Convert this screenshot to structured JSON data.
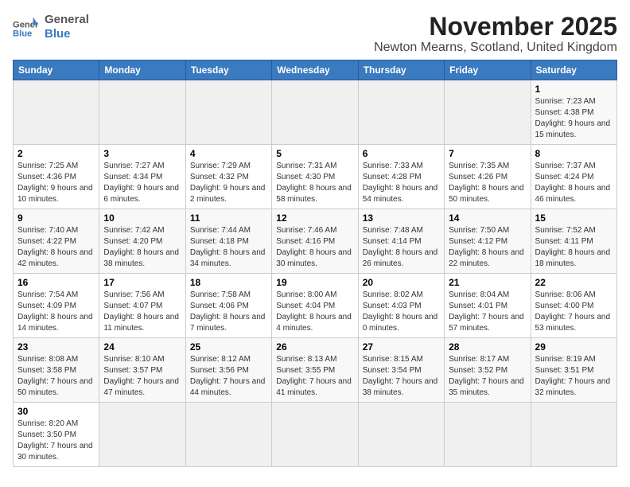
{
  "header": {
    "logo_general": "General",
    "logo_blue": "Blue",
    "month_title": "November 2025",
    "location": "Newton Mearns, Scotland, United Kingdom"
  },
  "weekdays": [
    "Sunday",
    "Monday",
    "Tuesday",
    "Wednesday",
    "Thursday",
    "Friday",
    "Saturday"
  ],
  "weeks": [
    [
      {
        "day": "",
        "info": ""
      },
      {
        "day": "",
        "info": ""
      },
      {
        "day": "",
        "info": ""
      },
      {
        "day": "",
        "info": ""
      },
      {
        "day": "",
        "info": ""
      },
      {
        "day": "",
        "info": ""
      },
      {
        "day": "1",
        "info": "Sunrise: 7:23 AM\nSunset: 4:38 PM\nDaylight: 9 hours and 15 minutes."
      }
    ],
    [
      {
        "day": "2",
        "info": "Sunrise: 7:25 AM\nSunset: 4:36 PM\nDaylight: 9 hours and 10 minutes."
      },
      {
        "day": "3",
        "info": "Sunrise: 7:27 AM\nSunset: 4:34 PM\nDaylight: 9 hours and 6 minutes."
      },
      {
        "day": "4",
        "info": "Sunrise: 7:29 AM\nSunset: 4:32 PM\nDaylight: 9 hours and 2 minutes."
      },
      {
        "day": "5",
        "info": "Sunrise: 7:31 AM\nSunset: 4:30 PM\nDaylight: 8 hours and 58 minutes."
      },
      {
        "day": "6",
        "info": "Sunrise: 7:33 AM\nSunset: 4:28 PM\nDaylight: 8 hours and 54 minutes."
      },
      {
        "day": "7",
        "info": "Sunrise: 7:35 AM\nSunset: 4:26 PM\nDaylight: 8 hours and 50 minutes."
      },
      {
        "day": "8",
        "info": "Sunrise: 7:37 AM\nSunset: 4:24 PM\nDaylight: 8 hours and 46 minutes."
      }
    ],
    [
      {
        "day": "9",
        "info": "Sunrise: 7:40 AM\nSunset: 4:22 PM\nDaylight: 8 hours and 42 minutes."
      },
      {
        "day": "10",
        "info": "Sunrise: 7:42 AM\nSunset: 4:20 PM\nDaylight: 8 hours and 38 minutes."
      },
      {
        "day": "11",
        "info": "Sunrise: 7:44 AM\nSunset: 4:18 PM\nDaylight: 8 hours and 34 minutes."
      },
      {
        "day": "12",
        "info": "Sunrise: 7:46 AM\nSunset: 4:16 PM\nDaylight: 8 hours and 30 minutes."
      },
      {
        "day": "13",
        "info": "Sunrise: 7:48 AM\nSunset: 4:14 PM\nDaylight: 8 hours and 26 minutes."
      },
      {
        "day": "14",
        "info": "Sunrise: 7:50 AM\nSunset: 4:12 PM\nDaylight: 8 hours and 22 minutes."
      },
      {
        "day": "15",
        "info": "Sunrise: 7:52 AM\nSunset: 4:11 PM\nDaylight: 8 hours and 18 minutes."
      }
    ],
    [
      {
        "day": "16",
        "info": "Sunrise: 7:54 AM\nSunset: 4:09 PM\nDaylight: 8 hours and 14 minutes."
      },
      {
        "day": "17",
        "info": "Sunrise: 7:56 AM\nSunset: 4:07 PM\nDaylight: 8 hours and 11 minutes."
      },
      {
        "day": "18",
        "info": "Sunrise: 7:58 AM\nSunset: 4:06 PM\nDaylight: 8 hours and 7 minutes."
      },
      {
        "day": "19",
        "info": "Sunrise: 8:00 AM\nSunset: 4:04 PM\nDaylight: 8 hours and 4 minutes."
      },
      {
        "day": "20",
        "info": "Sunrise: 8:02 AM\nSunset: 4:03 PM\nDaylight: 8 hours and 0 minutes."
      },
      {
        "day": "21",
        "info": "Sunrise: 8:04 AM\nSunset: 4:01 PM\nDaylight: 7 hours and 57 minutes."
      },
      {
        "day": "22",
        "info": "Sunrise: 8:06 AM\nSunset: 4:00 PM\nDaylight: 7 hours and 53 minutes."
      }
    ],
    [
      {
        "day": "23",
        "info": "Sunrise: 8:08 AM\nSunset: 3:58 PM\nDaylight: 7 hours and 50 minutes."
      },
      {
        "day": "24",
        "info": "Sunrise: 8:10 AM\nSunset: 3:57 PM\nDaylight: 7 hours and 47 minutes."
      },
      {
        "day": "25",
        "info": "Sunrise: 8:12 AM\nSunset: 3:56 PM\nDaylight: 7 hours and 44 minutes."
      },
      {
        "day": "26",
        "info": "Sunrise: 8:13 AM\nSunset: 3:55 PM\nDaylight: 7 hours and 41 minutes."
      },
      {
        "day": "27",
        "info": "Sunrise: 8:15 AM\nSunset: 3:54 PM\nDaylight: 7 hours and 38 minutes."
      },
      {
        "day": "28",
        "info": "Sunrise: 8:17 AM\nSunset: 3:52 PM\nDaylight: 7 hours and 35 minutes."
      },
      {
        "day": "29",
        "info": "Sunrise: 8:19 AM\nSunset: 3:51 PM\nDaylight: 7 hours and 32 minutes."
      }
    ],
    [
      {
        "day": "30",
        "info": "Sunrise: 8:20 AM\nSunset: 3:50 PM\nDaylight: 7 hours and 30 minutes."
      },
      {
        "day": "",
        "info": ""
      },
      {
        "day": "",
        "info": ""
      },
      {
        "day": "",
        "info": ""
      },
      {
        "day": "",
        "info": ""
      },
      {
        "day": "",
        "info": ""
      },
      {
        "day": "",
        "info": ""
      }
    ]
  ]
}
